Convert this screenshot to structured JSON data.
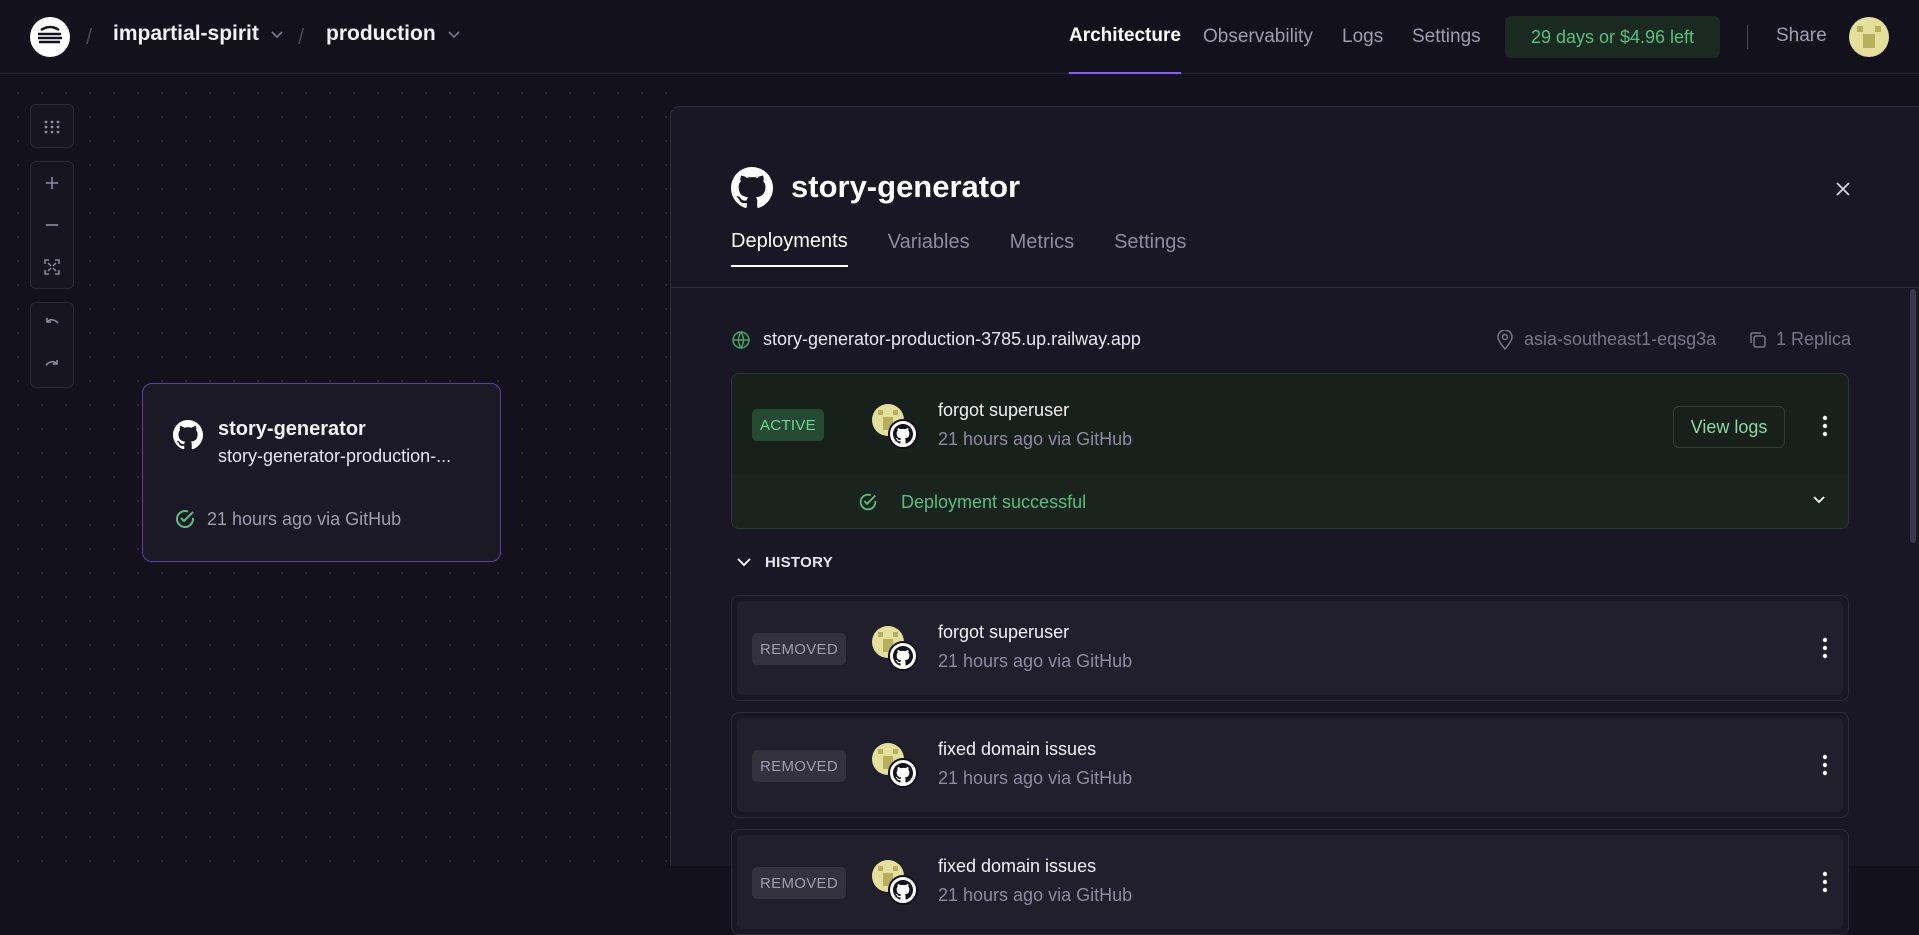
{
  "header": {
    "project": "impartial-spirit",
    "environment": "production",
    "nav": [
      "Architecture",
      "Observability",
      "Logs",
      "Settings"
    ],
    "active_nav": "Architecture",
    "trial": "29 days or $4.96 left",
    "share": "Share"
  },
  "canvas": {
    "service": {
      "name": "story-generator",
      "url_short": "story-generator-production-...",
      "status": "21 hours ago via GitHub"
    }
  },
  "panel": {
    "title": "story-generator",
    "tabs": [
      "Deployments",
      "Variables",
      "Metrics",
      "Settings"
    ],
    "active_tab": "Deployments",
    "domain": "story-generator-production-3785.up.railway.app",
    "region": "asia-southeast1-eqsg3a",
    "replicas": "1 Replica",
    "active_deployment": {
      "badge": "ACTIVE",
      "message": "forgot superuser",
      "meta": "21 hours ago via GitHub",
      "view_logs": "View logs",
      "status": "Deployment successful"
    },
    "history_label": "HISTORY",
    "history": [
      {
        "badge": "REMOVED",
        "message": "forgot superuser",
        "meta": "21 hours ago via GitHub"
      },
      {
        "badge": "REMOVED",
        "message": "fixed domain issues",
        "meta": "21 hours ago via GitHub"
      },
      {
        "badge": "REMOVED",
        "message": "fixed domain issues",
        "meta": "21 hours ago via GitHub"
      }
    ]
  },
  "colors": {
    "background": "#13111c",
    "accent": "#8b5cf6",
    "success": "#55c07c"
  }
}
